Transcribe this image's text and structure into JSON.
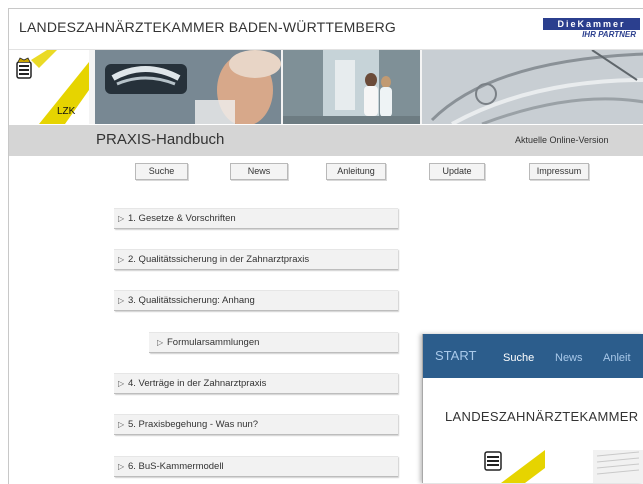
{
  "header": {
    "org_title": "LANDESZAHNÄRZTEKAMMER BADEN-WÜRTTEMBERG",
    "partner_logo_top": "DieKammer",
    "partner_logo_bottom": "IHR PARTNER"
  },
  "banner": {
    "logo_text": "LZK",
    "photos": [
      "dental-xray-photo",
      "clinic-staff-corridor-photo",
      "dental-instruments-photo"
    ]
  },
  "headline": {
    "title": "PRAXIS-Handbuch",
    "version": "Aktuelle Online-Version"
  },
  "nav": [
    "Suche",
    "News",
    "Anleitung",
    "Update",
    "Impressum"
  ],
  "menu": [
    "1. Gesetze & Vorschriften",
    "2. Qualitätssicherung in der Zahnarztpraxis",
    "3. Qualitätssicherung: Anhang",
    "Formularsammlungen",
    "4. Verträge in der Zahnarztpraxis",
    "5. Praxisbegehung - Was nun?",
    "6. BuS-Kammermodell"
  ],
  "overlay": {
    "start": "START",
    "links": [
      "Suche",
      "News",
      "Anleit"
    ],
    "title": "LANDESZAHNÄRZTEKAMMER"
  },
  "colors": {
    "accent_yellow": "#e6d400",
    "nav_blue": "#2c5d8c",
    "headline_gray": "#d5d5d5"
  }
}
